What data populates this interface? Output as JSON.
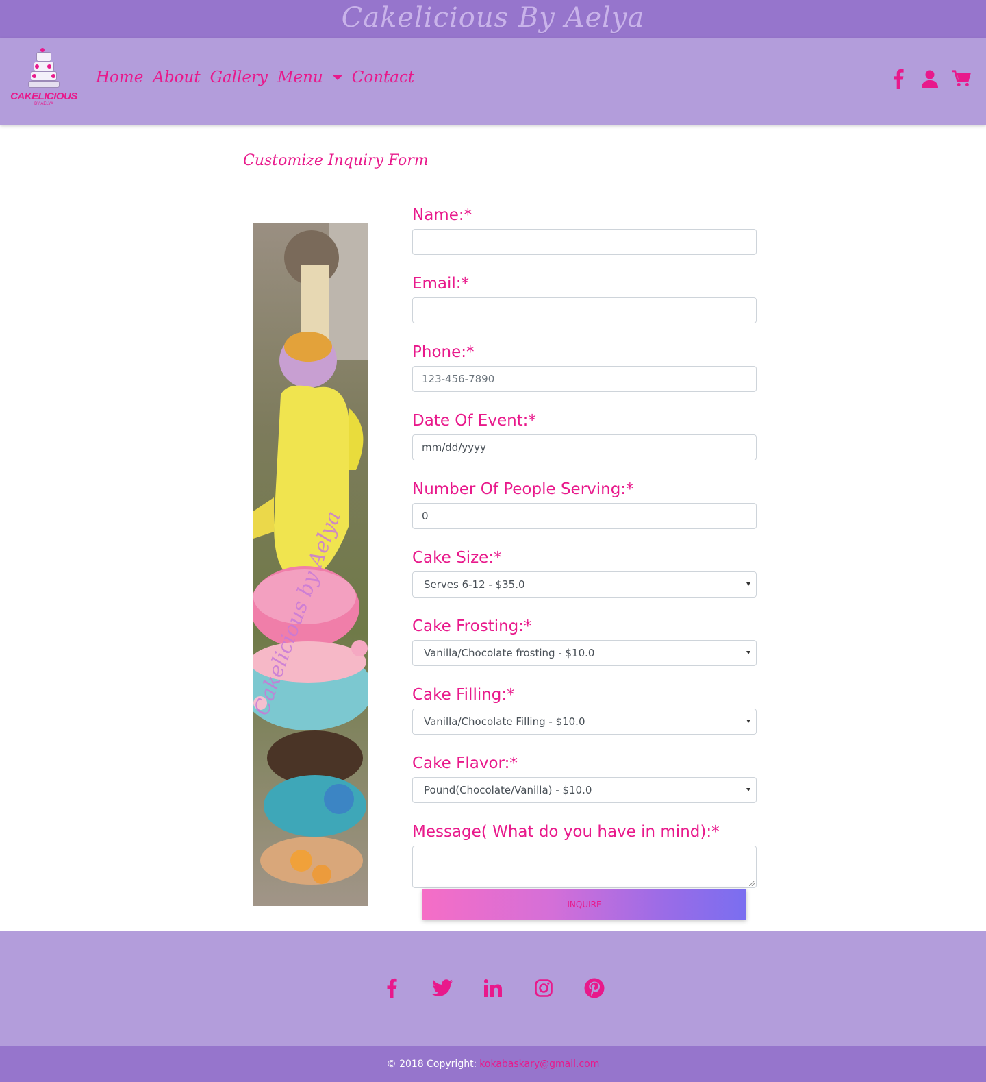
{
  "header": {
    "brand_title": "Cakelicious By Aelya"
  },
  "logo": {
    "wordmark": "CAKELICIOUS",
    "sub": "BY AELYA"
  },
  "nav": {
    "items": [
      {
        "label": "Home"
      },
      {
        "label": "About"
      },
      {
        "label": "Gallery"
      },
      {
        "label": "Menu"
      },
      {
        "label": "Contact"
      }
    ],
    "icons": [
      "facebook-icon",
      "user-icon",
      "cart-icon"
    ]
  },
  "page": {
    "form_title": "Customize Inquiry Form"
  },
  "form": {
    "name": {
      "label": "Name:*",
      "value": ""
    },
    "email": {
      "label": "Email:*",
      "value": ""
    },
    "phone": {
      "label": "Phone:*",
      "placeholder": "123-456-7890"
    },
    "date": {
      "label": "Date Of Event:*",
      "placeholder": "mm/dd/yyyy"
    },
    "people": {
      "label": "Number Of People Serving:*",
      "value": "0"
    },
    "cake_size": {
      "label": "Cake Size:*",
      "selected": "Serves 6-12 - $35.0"
    },
    "frosting": {
      "label": "Cake Frosting:*",
      "selected": "Vanilla/Chocolate frosting - $10.0"
    },
    "filling": {
      "label": "Cake Filling:*",
      "selected": "Vanilla/Chocolate Filling - $10.0"
    },
    "flavor": {
      "label": "Cake Flavor:*",
      "selected": "Pound(Chocolate/Vanilla) - $10.0"
    },
    "message": {
      "label": "Message( What do you have in mind):*",
      "value": ""
    },
    "submit_label": "Inquire"
  },
  "image": {
    "watermark": "Cakelicious by Aelya"
  },
  "footer": {
    "social": [
      "facebook-icon",
      "twitter-icon",
      "linkedin-icon",
      "instagram-icon",
      "pinterest-icon"
    ],
    "copyright": "© 2018 Copyright:",
    "email": "kokabaskary@gmail.com"
  },
  "colors": {
    "accent": "#e8198b",
    "header_bg": "#9675cc",
    "nav_bg": "#b39ddb"
  }
}
